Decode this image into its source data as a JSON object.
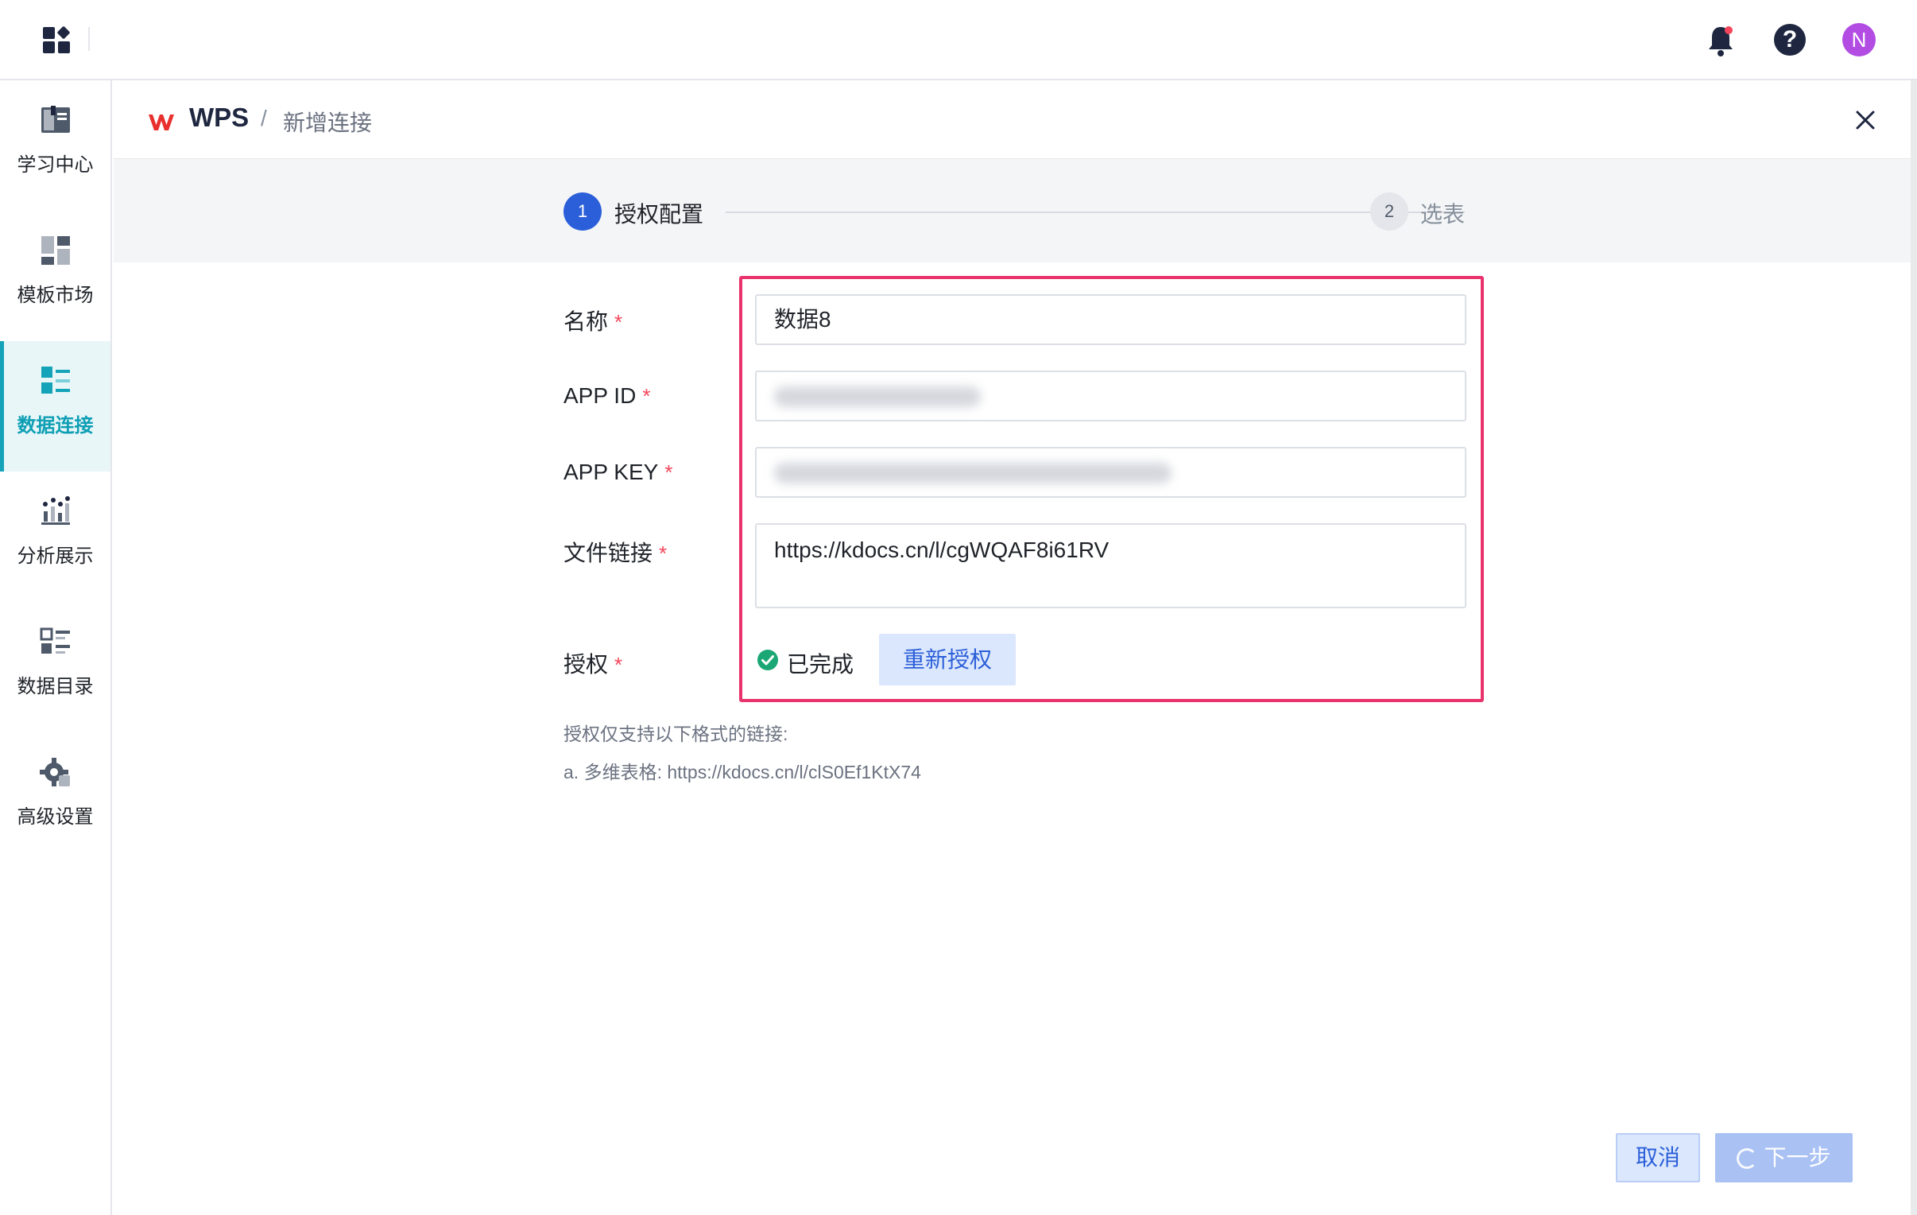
{
  "sidebar": {
    "items": [
      {
        "label": "学习中心",
        "icon": "book-icon"
      },
      {
        "label": "模板市场",
        "icon": "template-grid-icon"
      },
      {
        "label": "数据连接",
        "icon": "data-connect-icon",
        "active": true
      },
      {
        "label": "分析展示",
        "icon": "chart-icon"
      },
      {
        "label": "数据目录",
        "icon": "catalog-list-icon"
      },
      {
        "label": "高级设置",
        "icon": "gear-icon"
      }
    ]
  },
  "header": {
    "app_name": "WPS",
    "separator": "/",
    "page": "新增连接"
  },
  "steps": [
    {
      "number": "1",
      "label": "授权配置",
      "state": "active"
    },
    {
      "number": "2",
      "label": "选表",
      "state": "pending"
    }
  ],
  "form": {
    "required_mark": "*",
    "name_label": "名称",
    "name_value": "数据8",
    "app_id_label": "APP ID",
    "app_key_label": "APP KEY",
    "file_link_label": "文件链接",
    "file_link_value": "https://kdocs.cn/l/cgWQAF8i61RV",
    "auth_label": "授权",
    "auth_status": "已完成",
    "reauth_button": "重新授权"
  },
  "hints": {
    "line1": "授权仅支持以下格式的链接:",
    "line2": "a. 多维表格: https://kdocs.cn/l/clS0Ef1KtX74"
  },
  "footer": {
    "cancel": "取消",
    "next": "下一步"
  },
  "colors": {
    "accent": "#2b5fd9",
    "sidebar_active": "#14a3b8",
    "highlight": "#e8336d",
    "required": "#f5455a",
    "success": "#1aa775"
  }
}
